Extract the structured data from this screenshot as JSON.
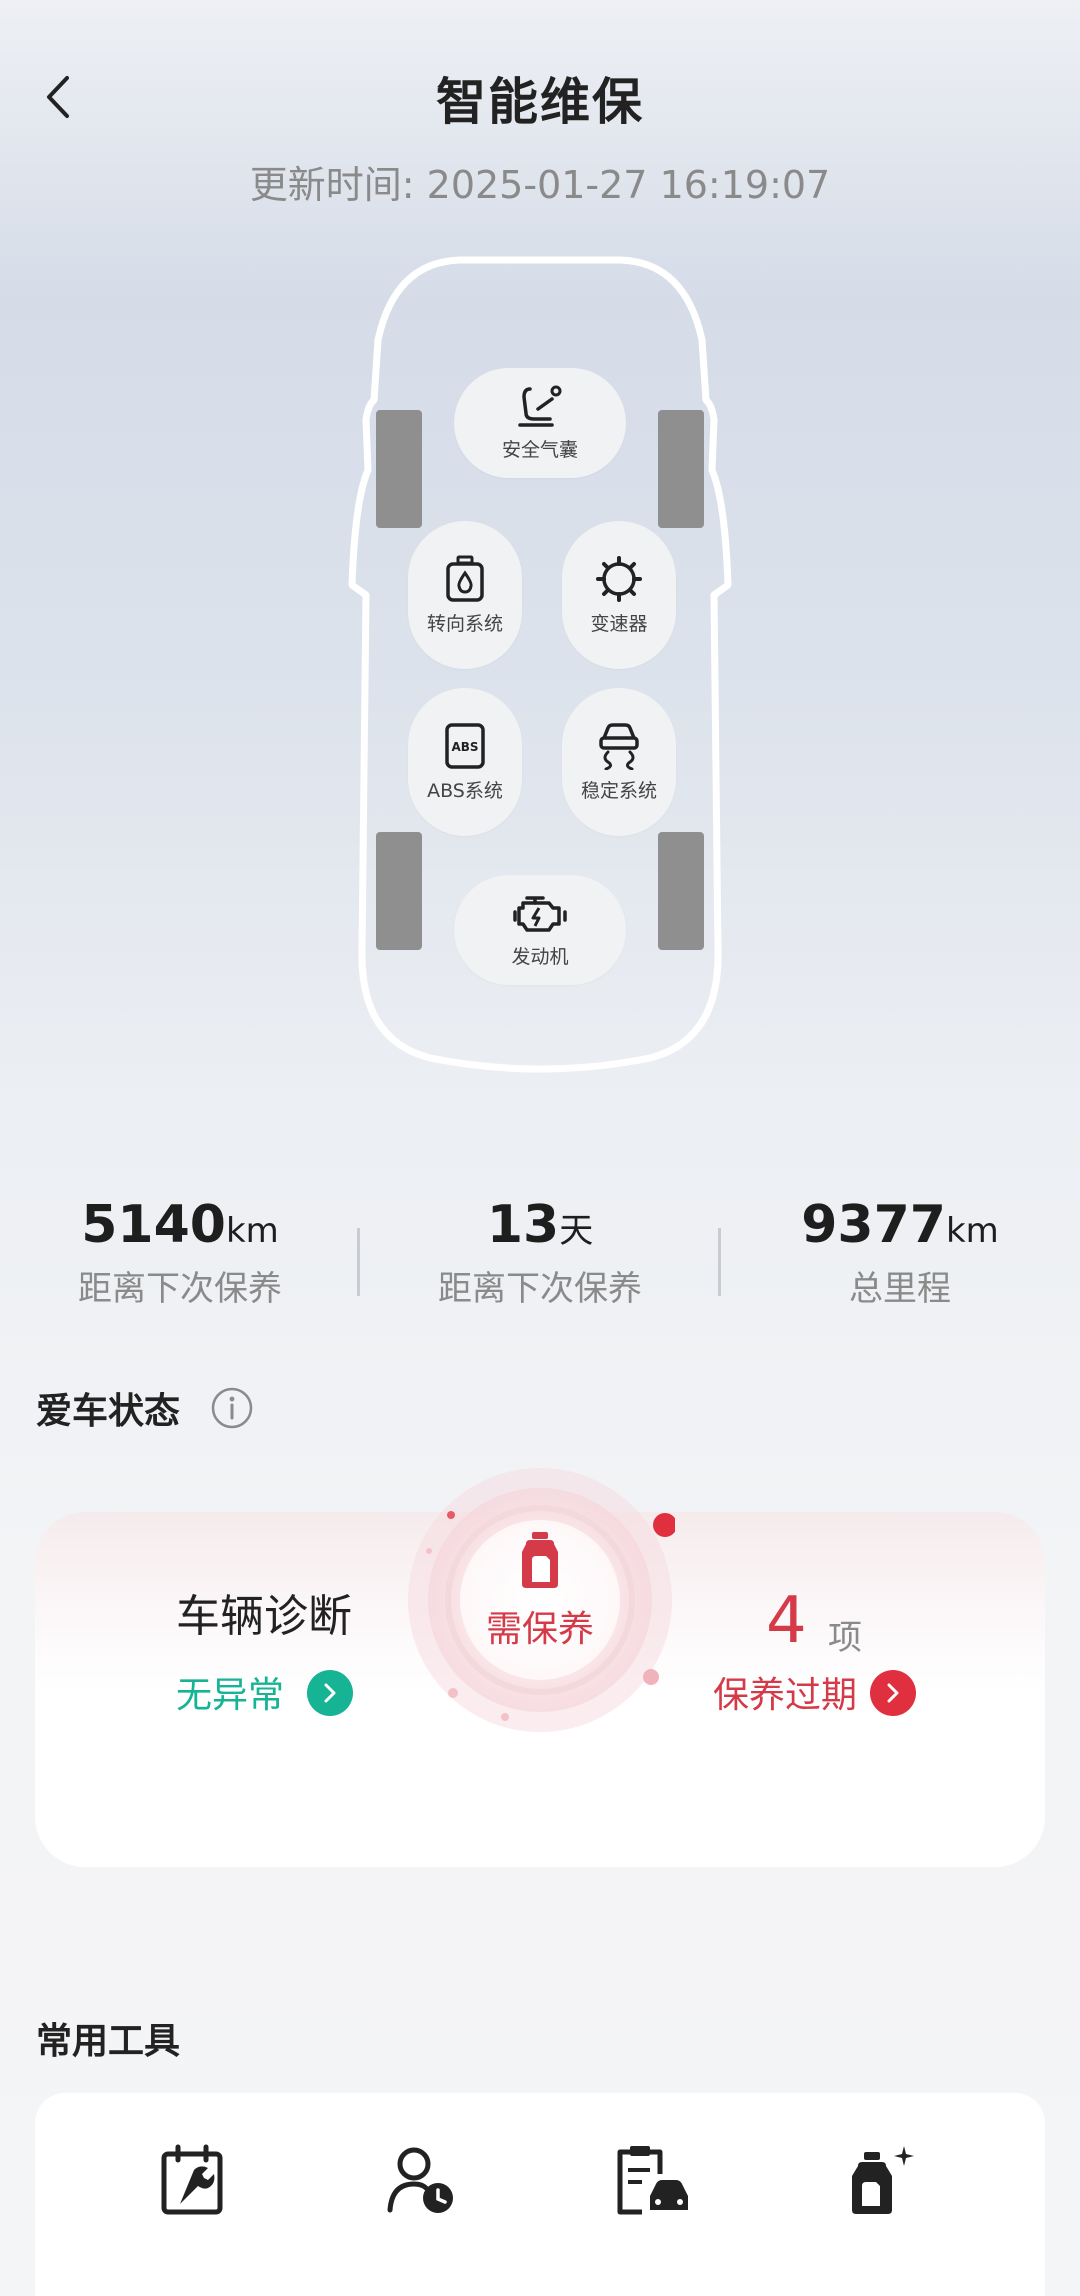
{
  "header": {
    "title": "智能维保",
    "update_time": "更新时间: 2025-01-27 16:19:07"
  },
  "systems": [
    {
      "label": "安全气囊",
      "icon": "seat-icon"
    },
    {
      "label": "转向系统",
      "icon": "steering-oil-icon"
    },
    {
      "label": "变速器",
      "icon": "gear-icon"
    },
    {
      "label": "ABS系统",
      "icon": "abs-icon"
    },
    {
      "label": "稳定系统",
      "icon": "stability-icon"
    },
    {
      "label": "发动机",
      "icon": "engine-icon"
    }
  ],
  "stats": [
    {
      "value": "5140",
      "unit": "km",
      "caption": "距离下次保养"
    },
    {
      "value": "13",
      "unit": "天",
      "caption": "距离下次保养"
    },
    {
      "value": "9377",
      "unit": "km",
      "caption": "总里程"
    }
  ],
  "car_status": {
    "title": "爱车状态",
    "diagnosis_label": "车辆诊断",
    "diagnosis_state": "无异常",
    "center_label": "需保养",
    "overdue_count": "4",
    "overdue_unit": "项",
    "overdue_label": "保养过期",
    "colors": {
      "ok": "#16b395",
      "alert": "#d43a48"
    }
  },
  "tools": {
    "title": "常用工具",
    "icons": [
      "maintenance-calendar-icon",
      "appointment-icon",
      "service-record-icon",
      "oil-care-icon"
    ]
  }
}
